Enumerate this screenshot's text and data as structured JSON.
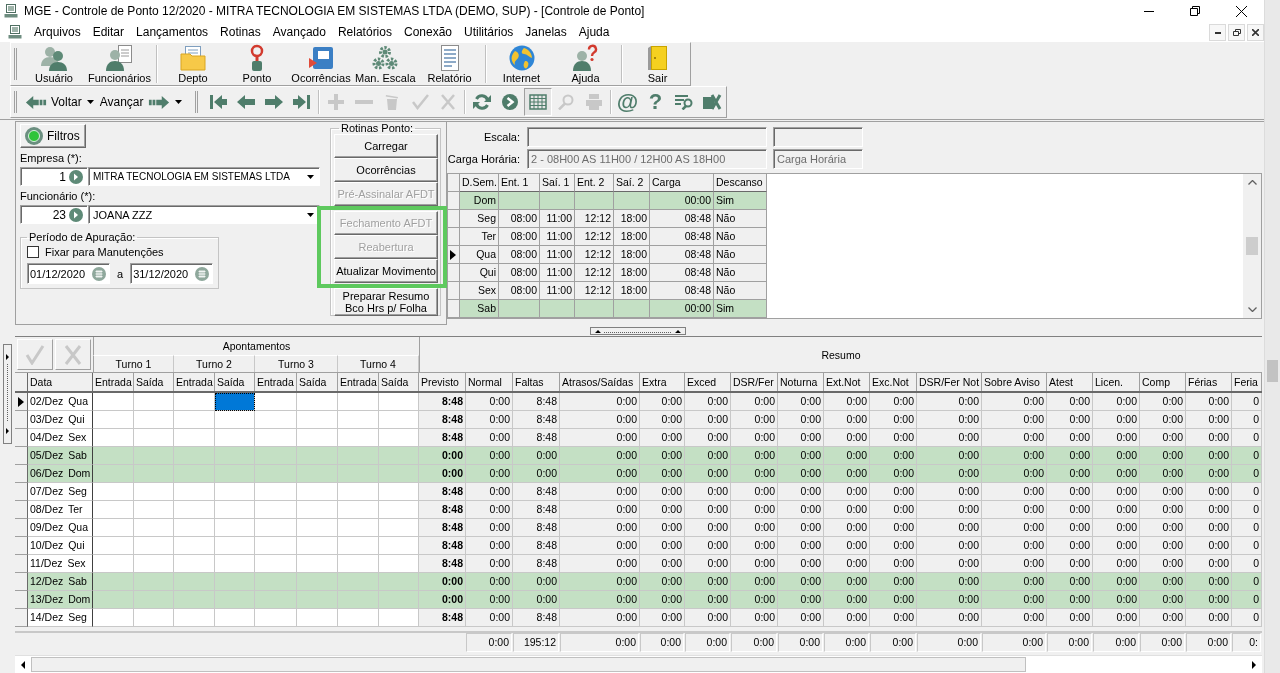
{
  "window": {
    "title": "MGE - Controle de Ponto 12/2020 - MITRA TECNOLOGIA EM SISTEMAS LTDA (DEMO, SUP) - [Controle de Ponto]"
  },
  "menu": [
    "Arquivos",
    "Editar",
    "Lançamentos",
    "Rotinas",
    "Avançado",
    "Relatórios",
    "Conexão",
    "Utilitários",
    "Janelas",
    "Ajuda"
  ],
  "main_toolbar": [
    [
      "Usuário",
      "Funcionários"
    ],
    [
      "Depto",
      "Ponto",
      "Ocorrências",
      "Man. Escala",
      "Relatório"
    ],
    [
      "Internet",
      "Ajuda"
    ],
    [
      "Sair"
    ]
  ],
  "nav_toolbar": {
    "back": "Voltar",
    "forward": "Avançar",
    "tools": [
      [
        {
          "disabled": false,
          "pressed": false
        },
        {
          "disabled": false,
          "pressed": false
        },
        {
          "disabled": false,
          "pressed": false
        },
        {
          "disabled": false,
          "pressed": false
        }
      ],
      [
        {
          "disabled": true,
          "pressed": false
        },
        {
          "disabled": true,
          "pressed": false
        },
        {
          "disabled": true,
          "pressed": false
        },
        {
          "disabled": true,
          "pressed": false
        },
        {
          "disabled": true,
          "pressed": false
        }
      ],
      [
        {
          "disabled": false,
          "pressed": false
        },
        {
          "disabled": false,
          "pressed": false
        },
        {
          "disabled": false,
          "pressed": true
        },
        {
          "disabled": true,
          "pressed": false
        },
        {
          "disabled": true,
          "pressed": false
        }
      ],
      [
        {
          "glyph": "@",
          "disabled": false,
          "pressed": false
        },
        {
          "glyph": "?",
          "disabled": false,
          "pressed": false
        },
        {
          "disabled": false,
          "pressed": false
        },
        {
          "disabled": false,
          "pressed": false
        }
      ]
    ]
  },
  "filters_button": "Filtros",
  "company": {
    "label": "Empresa (*):",
    "code": "1",
    "name": "MITRA TECNOLOGIA EM SISTEMAS LTDA"
  },
  "employee": {
    "label": "Funcionário (*):",
    "code": "23",
    "name": "JOANA ZZZ"
  },
  "period": {
    "legend": "Período de Apuração:",
    "fix_checkbox": {
      "label": "Fixar para Manutenções",
      "checked": false
    },
    "from": "01/12/2020",
    "separator": "a",
    "to": "31/12/2020"
  },
  "routines": {
    "legend": "Rotinas Ponto:",
    "buttons": [
      {
        "label": "Carregar",
        "disabled": false,
        "highlighted": false
      },
      {
        "label": "Ocorrências",
        "disabled": false,
        "highlighted": false
      },
      {
        "label": "Pré-Assinalar AFDT",
        "disabled": true,
        "highlighted": false
      },
      {
        "label": "Fechamento AFDT",
        "disabled": true,
        "highlighted": true
      },
      {
        "label": "Reabertura",
        "disabled": true,
        "highlighted": true
      },
      {
        "label": "Atualizar Movimento",
        "disabled": false,
        "highlighted": true
      },
      {
        "label": "Preparar Resumo Bco Hrs p/ Folha",
        "disabled": false,
        "highlighted": false
      }
    ]
  },
  "schedule": {
    "scale_label": "Escala:",
    "load_label": "Carga Horária:",
    "load_value": "2 - 08H00 AS 11H00 / 12H00 AS 18H00",
    "load_description": "Carga Horária",
    "columns": [
      "D.Sem.",
      "Ent. 1",
      "Saí. 1",
      "Ent. 2",
      "Saí. 2",
      "Carga",
      "Descanso"
    ],
    "rows": [
      {
        "day": "Dom",
        "current": false,
        "rest": true,
        "load": "00:00",
        "day_off": "Sim"
      },
      {
        "day": "Seg",
        "current": false,
        "rest": false,
        "times": [
          "08:00",
          "11:00",
          "12:12",
          "18:00"
        ],
        "load": "08:48",
        "day_off": "Não"
      },
      {
        "day": "Ter",
        "current": false,
        "rest": false,
        "times": [
          "08:00",
          "11:00",
          "12:12",
          "18:00"
        ],
        "load": "08:48",
        "day_off": "Não"
      },
      {
        "day": "Qua",
        "current": true,
        "rest": false,
        "times": [
          "08:00",
          "11:00",
          "12:12",
          "18:00"
        ],
        "load": "08:48",
        "day_off": "Não"
      },
      {
        "day": "Qui",
        "current": false,
        "rest": false,
        "times": [
          "08:00",
          "11:00",
          "12:12",
          "18:00"
        ],
        "load": "08:48",
        "day_off": "Não"
      },
      {
        "day": "Sex",
        "current": false,
        "rest": false,
        "times": [
          "08:00",
          "11:00",
          "12:12",
          "18:00"
        ],
        "load": "08:48",
        "day_off": "Não"
      },
      {
        "day": "Sab",
        "current": false,
        "rest": true,
        "load": "00:00",
        "day_off": "Sim"
      }
    ]
  },
  "grid": {
    "actions": [
      {
        "disabled": true
      },
      {
        "disabled": true
      }
    ],
    "punch_group": "Apontamentos",
    "shifts": [
      {
        "label": "Turno 1",
        "columns": [
          "Entrada",
          "Saída"
        ]
      },
      {
        "label": "Turno 2",
        "columns": [
          "Entrada",
          "Saída"
        ]
      },
      {
        "label": "Turno 3",
        "columns": [
          "Entrada",
          "Saída"
        ]
      },
      {
        "label": "Turno 4",
        "columns": [
          "Entrada",
          "Saída"
        ]
      }
    ],
    "date_column": "Data",
    "summary_group": "Resumo",
    "summary_columns": [
      {
        "label": "Previsto",
        "kind": "planned"
      },
      {
        "label": "Normal",
        "kind": "result",
        "total": "0:00"
      },
      {
        "label": "Faltas",
        "kind": "result",
        "total": "195:12"
      },
      {
        "label": "Atrasos/Saídas",
        "kind": "result",
        "total": "0:00"
      },
      {
        "label": "Extra",
        "kind": "result",
        "total": "0:00"
      },
      {
        "label": "Exced",
        "kind": "result",
        "total": "0:00"
      },
      {
        "label": "DSR/Fer",
        "kind": "result",
        "total": "0:00"
      },
      {
        "label": "Noturna",
        "kind": "result",
        "total": "0:00"
      },
      {
        "label": "Ext.Not",
        "kind": "result",
        "total": "0:00"
      },
      {
        "label": "Exc.Not",
        "kind": "result",
        "total": "0:00"
      },
      {
        "label": "DSR/Fer Not",
        "kind": "result",
        "total": "0:00"
      },
      {
        "label": "Sobre Aviso",
        "kind": "result",
        "total": "0:00"
      },
      {
        "label": "Atest",
        "kind": "result",
        "total": "0:00"
      },
      {
        "label": "Licen.",
        "kind": "result",
        "total": "0:00"
      },
      {
        "label": "Comp",
        "kind": "result",
        "total": "0:00"
      },
      {
        "label": "Férias",
        "kind": "result",
        "total": "0:00"
      },
      {
        "label": "Feria",
        "kind": "result",
        "total": "0:"
      }
    ],
    "rows": [
      {
        "date": "02/Dez Qua",
        "current": true,
        "rest": false,
        "punches": [
          {
            "selected": false
          },
          {
            "selected": false
          },
          {
            "selected": false
          },
          {
            "selected": true
          },
          {
            "selected": false
          },
          {
            "selected": false
          },
          {
            "selected": false
          },
          {
            "selected": false
          }
        ],
        "values": [
          "8:48",
          "0:00",
          "8:48",
          "0:00",
          "0:00",
          "0:00",
          "0:00",
          "0:00",
          "0:00",
          "0:00",
          "0:00",
          "0:00",
          "0:00",
          "0:00",
          "0:00",
          "0:00",
          "0"
        ]
      },
      {
        "date": "03/Dez Qui",
        "current": false,
        "rest": false,
        "punches": [
          {
            "selected": false
          },
          {
            "selected": false
          },
          {
            "selected": false
          },
          {
            "selected": false
          },
          {
            "selected": false
          },
          {
            "selected": false
          },
          {
            "selected": false
          },
          {
            "selected": false
          }
        ],
        "values": [
          "8:48",
          "0:00",
          "8:48",
          "0:00",
          "0:00",
          "0:00",
          "0:00",
          "0:00",
          "0:00",
          "0:00",
          "0:00",
          "0:00",
          "0:00",
          "0:00",
          "0:00",
          "0:00",
          "0"
        ]
      },
      {
        "date": "04/Dez Sex",
        "current": false,
        "rest": false,
        "punches": [
          {
            "selected": false
          },
          {
            "selected": false
          },
          {
            "selected": false
          },
          {
            "selected": false
          },
          {
            "selected": false
          },
          {
            "selected": false
          },
          {
            "selected": false
          },
          {
            "selected": false
          }
        ],
        "values": [
          "8:48",
          "0:00",
          "8:48",
          "0:00",
          "0:00",
          "0:00",
          "0:00",
          "0:00",
          "0:00",
          "0:00",
          "0:00",
          "0:00",
          "0:00",
          "0:00",
          "0:00",
          "0:00",
          "0"
        ]
      },
      {
        "date": "05/Dez Sab",
        "current": false,
        "rest": true,
        "punches": [
          {
            "selected": false
          },
          {
            "selected": false
          },
          {
            "selected": false
          },
          {
            "selected": false
          },
          {
            "selected": false
          },
          {
            "selected": false
          },
          {
            "selected": false
          },
          {
            "selected": false
          }
        ],
        "values": [
          "0:00",
          "0:00",
          "0:00",
          "0:00",
          "0:00",
          "0:00",
          "0:00",
          "0:00",
          "0:00",
          "0:00",
          "0:00",
          "0:00",
          "0:00",
          "0:00",
          "0:00",
          "0:00",
          "0"
        ]
      },
      {
        "date": "06/Dez Dom",
        "current": false,
        "rest": true,
        "punches": [
          {
            "selected": false
          },
          {
            "selected": false
          },
          {
            "selected": false
          },
          {
            "selected": false
          },
          {
            "selected": false
          },
          {
            "selected": false
          },
          {
            "selected": false
          },
          {
            "selected": false
          }
        ],
        "values": [
          "0:00",
          "0:00",
          "0:00",
          "0:00",
          "0:00",
          "0:00",
          "0:00",
          "0:00",
          "0:00",
          "0:00",
          "0:00",
          "0:00",
          "0:00",
          "0:00",
          "0:00",
          "0:00",
          "0"
        ]
      },
      {
        "date": "07/Dez Seg",
        "current": false,
        "rest": false,
        "punches": [
          {
            "selected": false
          },
          {
            "selected": false
          },
          {
            "selected": false
          },
          {
            "selected": false
          },
          {
            "selected": false
          },
          {
            "selected": false
          },
          {
            "selected": false
          },
          {
            "selected": false
          }
        ],
        "values": [
          "8:48",
          "0:00",
          "8:48",
          "0:00",
          "0:00",
          "0:00",
          "0:00",
          "0:00",
          "0:00",
          "0:00",
          "0:00",
          "0:00",
          "0:00",
          "0:00",
          "0:00",
          "0:00",
          "0"
        ]
      },
      {
        "date": "08/Dez Ter",
        "current": false,
        "rest": false,
        "punches": [
          {
            "selected": false
          },
          {
            "selected": false
          },
          {
            "selected": false
          },
          {
            "selected": false
          },
          {
            "selected": false
          },
          {
            "selected": false
          },
          {
            "selected": false
          },
          {
            "selected": false
          }
        ],
        "values": [
          "8:48",
          "0:00",
          "8:48",
          "0:00",
          "0:00",
          "0:00",
          "0:00",
          "0:00",
          "0:00",
          "0:00",
          "0:00",
          "0:00",
          "0:00",
          "0:00",
          "0:00",
          "0:00",
          "0"
        ]
      },
      {
        "date": "09/Dez Qua",
        "current": false,
        "rest": false,
        "punches": [
          {
            "selected": false
          },
          {
            "selected": false
          },
          {
            "selected": false
          },
          {
            "selected": false
          },
          {
            "selected": false
          },
          {
            "selected": false
          },
          {
            "selected": false
          },
          {
            "selected": false
          }
        ],
        "values": [
          "8:48",
          "0:00",
          "8:48",
          "0:00",
          "0:00",
          "0:00",
          "0:00",
          "0:00",
          "0:00",
          "0:00",
          "0:00",
          "0:00",
          "0:00",
          "0:00",
          "0:00",
          "0:00",
          "0"
        ]
      },
      {
        "date": "10/Dez Qui",
        "current": false,
        "rest": false,
        "punches": [
          {
            "selected": false
          },
          {
            "selected": false
          },
          {
            "selected": false
          },
          {
            "selected": false
          },
          {
            "selected": false
          },
          {
            "selected": false
          },
          {
            "selected": false
          },
          {
            "selected": false
          }
        ],
        "values": [
          "8:48",
          "0:00",
          "8:48",
          "0:00",
          "0:00",
          "0:00",
          "0:00",
          "0:00",
          "0:00",
          "0:00",
          "0:00",
          "0:00",
          "0:00",
          "0:00",
          "0:00",
          "0:00",
          "0"
        ]
      },
      {
        "date": "11/Dez Sex",
        "current": false,
        "rest": false,
        "punches": [
          {
            "selected": false
          },
          {
            "selected": false
          },
          {
            "selected": false
          },
          {
            "selected": false
          },
          {
            "selected": false
          },
          {
            "selected": false
          },
          {
            "selected": false
          },
          {
            "selected": false
          }
        ],
        "values": [
          "8:48",
          "0:00",
          "8:48",
          "0:00",
          "0:00",
          "0:00",
          "0:00",
          "0:00",
          "0:00",
          "0:00",
          "0:00",
          "0:00",
          "0:00",
          "0:00",
          "0:00",
          "0:00",
          "0"
        ]
      },
      {
        "date": "12/Dez Sab",
        "current": false,
        "rest": true,
        "punches": [
          {
            "selected": false
          },
          {
            "selected": false
          },
          {
            "selected": false
          },
          {
            "selected": false
          },
          {
            "selected": false
          },
          {
            "selected": false
          },
          {
            "selected": false
          },
          {
            "selected": false
          }
        ],
        "values": [
          "0:00",
          "0:00",
          "0:00",
          "0:00",
          "0:00",
          "0:00",
          "0:00",
          "0:00",
          "0:00",
          "0:00",
          "0:00",
          "0:00",
          "0:00",
          "0:00",
          "0:00",
          "0:00",
          "0"
        ]
      },
      {
        "date": "13/Dez Dom",
        "current": false,
        "rest": true,
        "punches": [
          {
            "selected": false
          },
          {
            "selected": false
          },
          {
            "selected": false
          },
          {
            "selected": false
          },
          {
            "selected": false
          },
          {
            "selected": false
          },
          {
            "selected": false
          },
          {
            "selected": false
          }
        ],
        "values": [
          "0:00",
          "0:00",
          "0:00",
          "0:00",
          "0:00",
          "0:00",
          "0:00",
          "0:00",
          "0:00",
          "0:00",
          "0:00",
          "0:00",
          "0:00",
          "0:00",
          "0:00",
          "0:00",
          "0"
        ]
      },
      {
        "date": "14/Dez Seg",
        "current": false,
        "rest": false,
        "punches": [
          {
            "selected": false
          },
          {
            "selected": false
          },
          {
            "selected": false
          },
          {
            "selected": false
          },
          {
            "selected": false
          },
          {
            "selected": false
          },
          {
            "selected": false
          },
          {
            "selected": false
          }
        ],
        "values": [
          "8:48",
          "0:00",
          "8:48",
          "0:00",
          "0:00",
          "0:00",
          "0:00",
          "0:00",
          "0:00",
          "0:00",
          "0:00",
          "0:00",
          "0:00",
          "0:00",
          "0:00",
          "0:00",
          "0"
        ]
      }
    ]
  }
}
